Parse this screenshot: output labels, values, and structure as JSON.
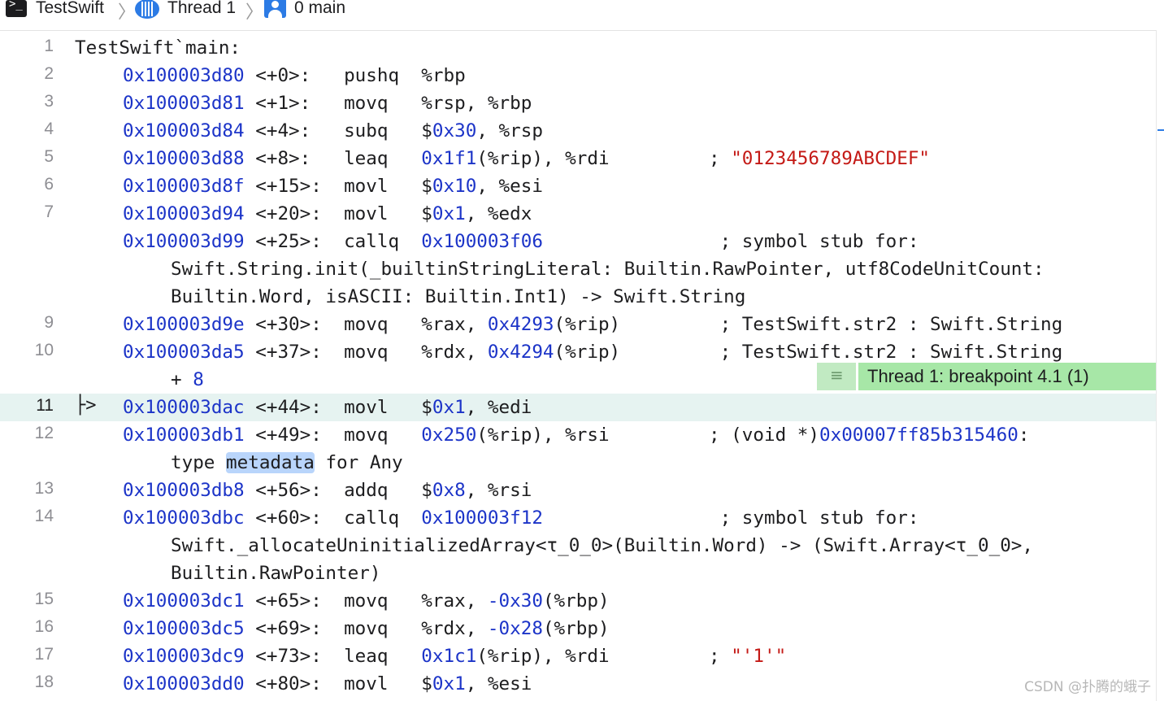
{
  "jumpbar": {
    "project": "TestSwift",
    "thread": "Thread 1",
    "frame": "0 main",
    "separator": "〉",
    "terminal_icon_text": ">_"
  },
  "gutter": {
    "l1": "1",
    "l2": "2",
    "l3": "3",
    "l4": "4",
    "l5": "5",
    "l6": "6",
    "l7": "7",
    "l9": "9",
    "l10": "10",
    "l11": "11",
    "l12": "12",
    "l13": "13",
    "l14": "14",
    "l15": "15",
    "l16": "16",
    "l17": "17",
    "l18": "18"
  },
  "current_line_arrow": "├>",
  "code": {
    "l1": {
      "text": "TestSwift`main:"
    },
    "l2": {
      "addr": "0x100003d80",
      "off": " <+0>:   ",
      "op": "pushq  ",
      "args": "%rbp"
    },
    "l3": {
      "addr": "0x100003d81",
      "off": " <+1>:   ",
      "op": "movq   ",
      "args": "%rsp, %rbp"
    },
    "l4": {
      "addr": "0x100003d84",
      "off": " <+4>:   ",
      "op": "subq   ",
      "a1": "$",
      "n1": "0x30",
      "a2": ", %rsp"
    },
    "l5": {
      "addr": "0x100003d88",
      "off": " <+8>:   ",
      "op": "leaq   ",
      "n1": "0x1f1",
      "a2": "(%rip), %rdi         ; ",
      "str": "\"0123456789ABCDEF\""
    },
    "l6": {
      "addr": "0x100003d8f",
      "off": " <+15>:  ",
      "op": "movl   ",
      "a1": "$",
      "n1": "0x10",
      "a2": ", %esi"
    },
    "l7": {
      "addr": "0x100003d94",
      "off": " <+20>:  ",
      "op": "movl   ",
      "a1": "$",
      "n1": "0x1",
      "a2": ", %edx"
    },
    "l8": {
      "addr": "0x100003d99",
      "off": " <+25>:  ",
      "op": "callq  ",
      "n1": "0x100003f06",
      "a2": "                ; symbol stub for:"
    },
    "l8b": "Swift.String.init(_builtinStringLiteral: Builtin.RawPointer, utf8CodeUnitCount:",
    "l8c": "Builtin.Word, isASCII: Builtin.Int1) -> Swift.String",
    "l9": {
      "addr": "0x100003d9e",
      "off": " <+30>:  ",
      "op": "movq   ",
      "a1": "%rax, ",
      "n1": "0x4293",
      "a2": "(%rip)         ; TestSwift.str2 : Swift.String"
    },
    "l10": {
      "addr": "0x100003da5",
      "off": " <+37>:  ",
      "op": "movq   ",
      "a1": "%rdx, ",
      "n1": "0x4294",
      "a2": "(%rip)         ; TestSwift.str2 : Swift.String"
    },
    "l10b": {
      "text": "+ ",
      "n": "8"
    },
    "l11": {
      "addr": "0x100003dac",
      "off": " <+44>:  ",
      "op": "movl   ",
      "a1": "$",
      "n1": "0x1",
      "a2": ", %edi"
    },
    "l12": {
      "addr": "0x100003db1",
      "off": " <+49>:  ",
      "op": "movq   ",
      "n1": "0x250",
      "a2": "(%rip), %rsi         ; (void *)",
      "n2": "0x00007ff85b315460",
      "a3": ":"
    },
    "l12b": {
      "pre": "type ",
      "hl": "metadata",
      "post": " for Any"
    },
    "l13": {
      "addr": "0x100003db8",
      "off": " <+56>:  ",
      "op": "addq   ",
      "a1": "$",
      "n1": "0x8",
      "a2": ", %rsi"
    },
    "l14": {
      "addr": "0x100003dbc",
      "off": " <+60>:  ",
      "op": "callq  ",
      "n1": "0x100003f12",
      "a2": "                ; symbol stub for:"
    },
    "l14b": "Swift._allocateUninitializedArray<τ_0_0>(Builtin.Word) -> (Swift.Array<τ_0_0>,",
    "l14c": "Builtin.RawPointer)",
    "l15": {
      "addr": "0x100003dc1",
      "off": " <+65>:  ",
      "op": "movq   ",
      "a1": "%rax, ",
      "n1": "-0x30",
      "a2": "(%rbp)"
    },
    "l16": {
      "addr": "0x100003dc5",
      "off": " <+69>:  ",
      "op": "movq   ",
      "a1": "%rdx, ",
      "n1": "-0x28",
      "a2": "(%rbp)"
    },
    "l17": {
      "addr": "0x100003dc9",
      "off": " <+73>:  ",
      "op": "leaq   ",
      "n1": "0x1c1",
      "a2": "(%rip), %rdi         ; ",
      "str": "\"'1'\""
    },
    "l18": {
      "addr": "0x100003dd0",
      "off": " <+80>:  ",
      "op": "movl   ",
      "a1": "$",
      "n1": "0x1",
      "a2": ", %esi"
    }
  },
  "breakpoint": {
    "badge_icon": "≡",
    "label": "Thread 1: breakpoint 4.1 (1)"
  },
  "watermark": "CSDN @扑腾的蛾子",
  "colors": {
    "address": "#1c34c8",
    "string_literal": "#c41a16",
    "current_line_bg": "#e6f3f1",
    "breakpoint_label_bg": "#a7e7a7",
    "breakpoint_badge_bg": "#c1eac2",
    "icon_blue": "#2c7be5"
  }
}
